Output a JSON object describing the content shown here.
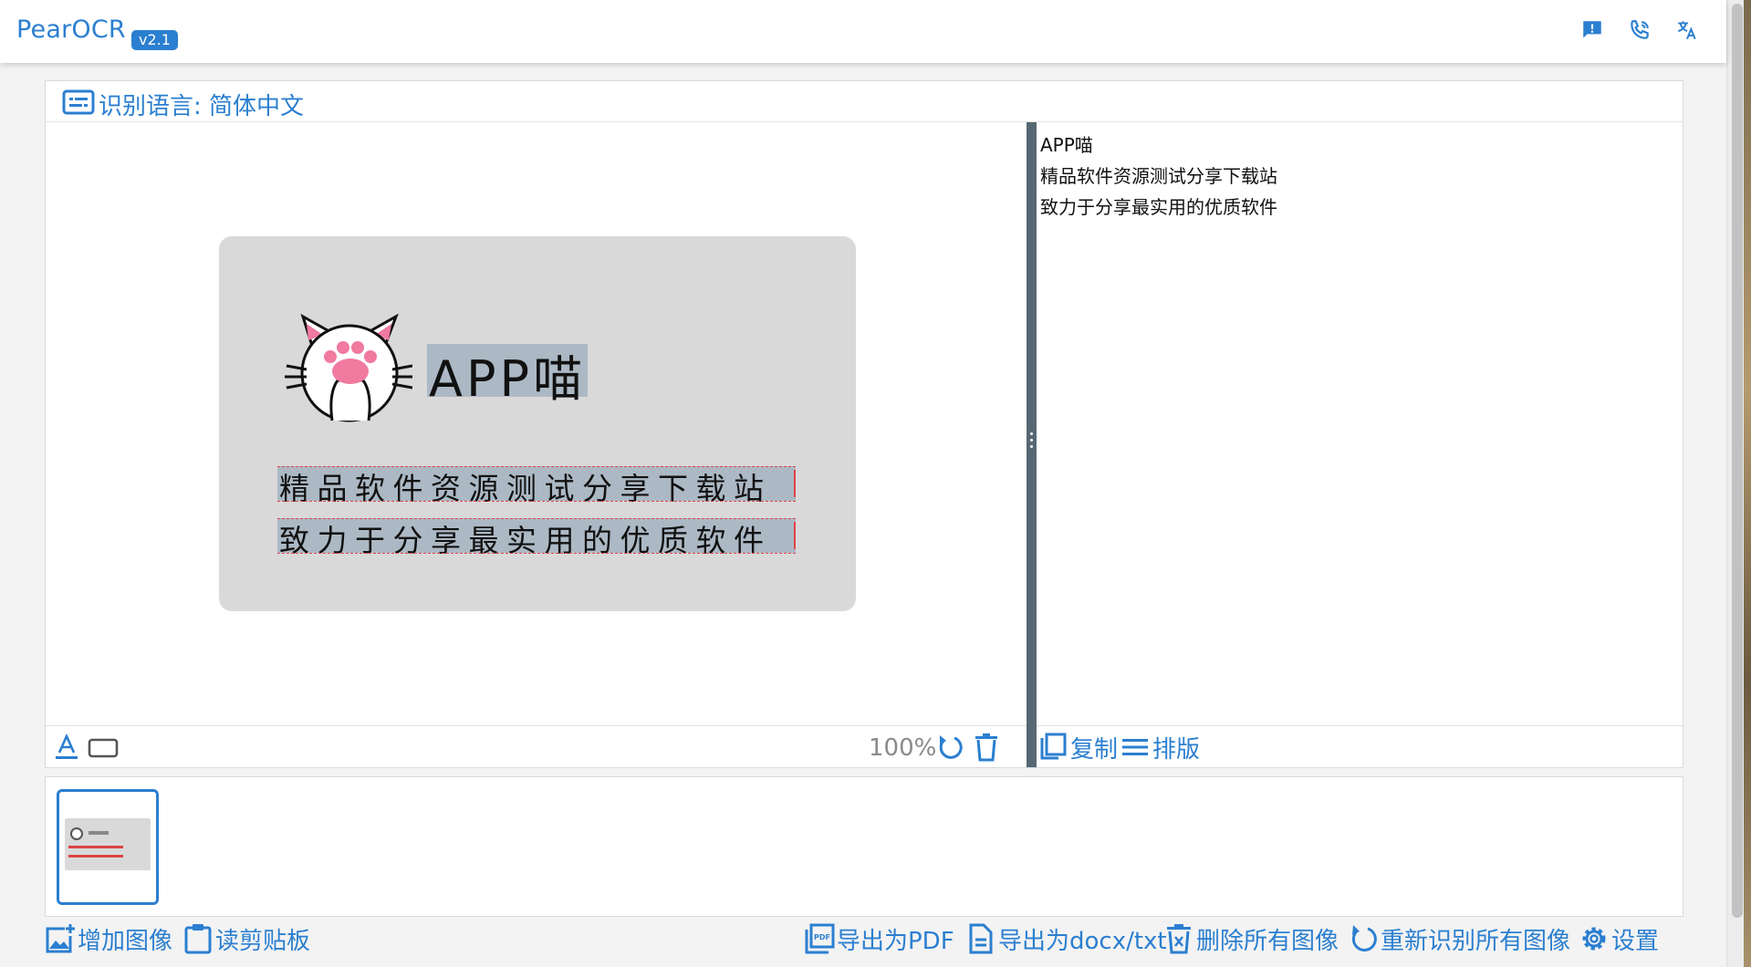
{
  "app": {
    "title": "PearOCR",
    "version": "v2.1"
  },
  "header_icons": [
    {
      "icon": "feedback-icon"
    },
    {
      "icon": "contact-phone-icon"
    },
    {
      "icon": "translate-icon"
    }
  ],
  "language_bar": {
    "label": "识别语言: 简体中文"
  },
  "image_preview": {
    "lines": [
      "APP喵",
      "精品软件资源测试分享下载站",
      "致力于分享最实用的优质软件"
    ]
  },
  "image_toolbar": {
    "zoom": "100%"
  },
  "result": {
    "lines": [
      "APP喵",
      "精品软件资源测试分享下载站",
      "致力于分享最实用的优质软件"
    ]
  },
  "result_toolbar": {
    "copy_label": "复制",
    "layout_label": "排版"
  },
  "bottom_bar": {
    "add_image": "增加图像",
    "read_clipboard": "读剪贴板",
    "export_pdf": "导出为PDF",
    "export_docx": "导出为docx/txt",
    "delete_all": "删除所有图像",
    "rerecognize_all": "重新识别所有图像",
    "settings": "设置"
  },
  "colors": {
    "accent": "#2b7fd0",
    "divider": "#566873",
    "highlight": "#e0434b"
  }
}
